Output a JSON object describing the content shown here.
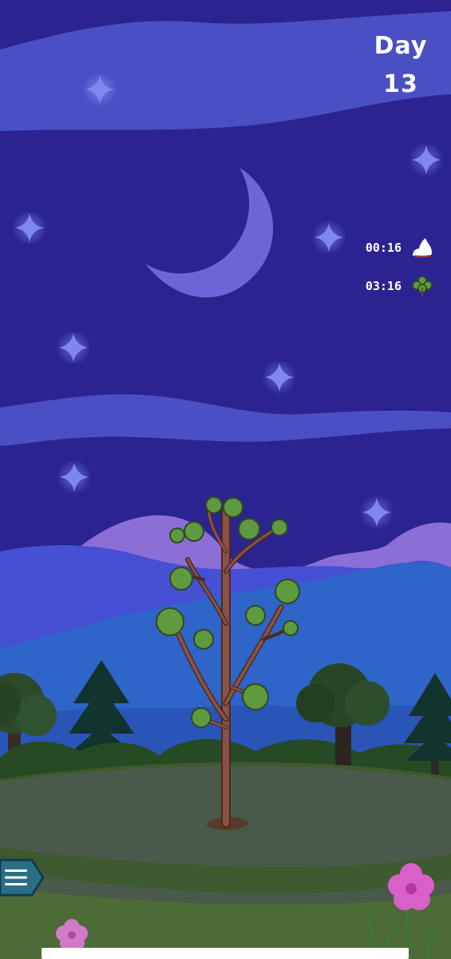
{
  "hud": {
    "day_word": "Day",
    "day_number": "13",
    "timers": [
      {
        "value": "00:16",
        "icon": "snow-cloud-icon"
      },
      {
        "value": "03:16",
        "icon": "leaf-icon"
      }
    ]
  },
  "menu": {
    "icon": "hamburger-menu-icon"
  },
  "scene": {
    "time_of_day": "night",
    "colors": {
      "sky": "#2b2490",
      "cloud_band": "#4a4fc4",
      "moon": "#6e64d8",
      "star": "#7f86ee",
      "far_mountains": "#8b6fd6",
      "hills": "#3f5fcf",
      "ground": "#4a5a4a",
      "trunk": "#7a4a3a",
      "leaves": "#5f9a3e"
    }
  }
}
